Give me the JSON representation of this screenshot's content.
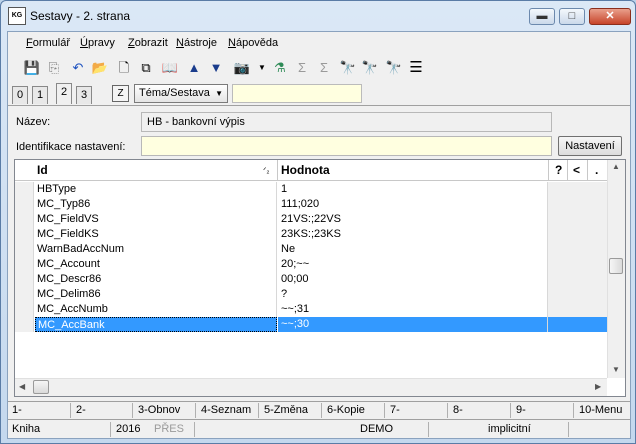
{
  "window": {
    "title": "Sestavy - 2. strana",
    "app_icon_text": "KG",
    "minimize": "▬",
    "maximize": "□",
    "close": "✕"
  },
  "menu": [
    {
      "label": "Formulář",
      "accel": "F",
      "rest": "ormulář"
    },
    {
      "label": "Úpravy",
      "accel": "Ú",
      "rest": "pravy"
    },
    {
      "label": "Zobrazit",
      "accel": "Z",
      "rest": "obrazit"
    },
    {
      "label": "Nástroje",
      "accel": "N",
      "rest": "ástroje"
    },
    {
      "label": "Nápověda",
      "accel": "N",
      "rest": "ápověda"
    }
  ],
  "toolbar": {
    "icons": [
      "save-icon",
      "save-as-icon",
      "undo-icon",
      "open-folder-icon",
      "new-document-icon",
      "copy-icon",
      "book-icon",
      "arrow-up-icon",
      "arrow-down-icon",
      "camera-icon",
      "filter-icon",
      "sum-icon",
      "sum-disabled-icon",
      "binoculars-icon",
      "binoculars-next-icon",
      "find-replace-icon",
      "menu-lines-icon"
    ],
    "glyphs": [
      "💾",
      "⎘",
      "↶",
      "📂",
      "🗋",
      "⧉",
      "📖",
      "▲",
      "▼",
      "📷",
      "⚗",
      "Σ",
      "Σ",
      "🔭",
      "🔭",
      "🔭",
      "☰"
    ]
  },
  "tabs": [
    "0",
    "1",
    "2",
    "3"
  ],
  "active_tab": "2",
  "z_button": "Z",
  "combo": {
    "value": "Téma/Sestava"
  },
  "form": {
    "name_label": "Název:",
    "name_value": "HB - bankovní výpis",
    "ident_label": "Identifikace nastavení:",
    "ident_value": "",
    "settings_button": "Nastavení"
  },
  "grid": {
    "columns": [
      "Id",
      "Hodnota",
      "?",
      "<",
      "."
    ],
    "sort_marker": "ᐟ₂",
    "rows": [
      {
        "id": "HBType",
        "value": "1"
      },
      {
        "id": "MC_Typ86",
        "value": "111;020"
      },
      {
        "id": "MC_FieldVS",
        "value": "21VS:;22VS"
      },
      {
        "id": "MC_FieldKS",
        "value": "23KS:;23KS"
      },
      {
        "id": "WarnBadAccNum",
        "value": "Ne"
      },
      {
        "id": "MC_Account",
        "value": "20;~~"
      },
      {
        "id": "MC_Descr86",
        "value": "00;00"
      },
      {
        "id": "MC_Delim86",
        "value": "?"
      },
      {
        "id": "MC_AccNumb",
        "value": "~~;31"
      },
      {
        "id": "MC_AccBank",
        "value": "~~;30"
      }
    ],
    "selected_index": 9
  },
  "fkeys": [
    "1-",
    "2-",
    "3-Obnov",
    "4-Seznam",
    "5-Změna",
    "6-Kopie",
    "7-",
    "8-",
    "9-",
    "10-Menu"
  ],
  "status": {
    "module": "Kniha",
    "year": "2016",
    "mode": "PŘES",
    "database": "DEMO",
    "setting": "implicitní"
  }
}
